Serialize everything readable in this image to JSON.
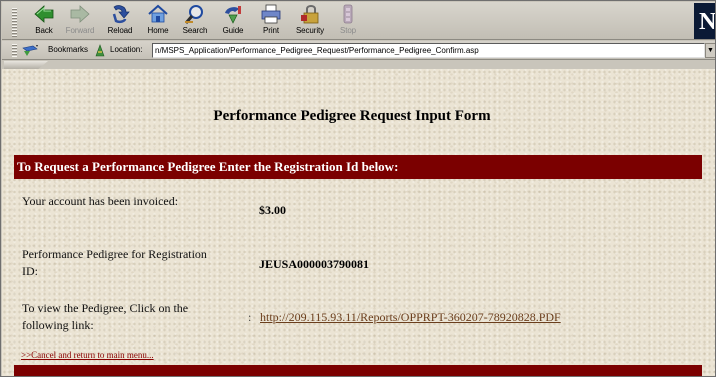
{
  "toolbar": {
    "buttons": [
      {
        "label": "Back",
        "icon": "back-arrow-icon",
        "enabled": true
      },
      {
        "label": "Forward",
        "icon": "forward-arrow-icon",
        "enabled": false
      },
      {
        "label": "Reload",
        "icon": "reload-icon",
        "enabled": true
      },
      {
        "label": "Home",
        "icon": "home-icon",
        "enabled": true
      },
      {
        "label": "Search",
        "icon": "search-icon",
        "enabled": true
      },
      {
        "label": "Guide",
        "icon": "guide-icon",
        "enabled": true
      },
      {
        "label": "Print",
        "icon": "print-icon",
        "enabled": true
      },
      {
        "label": "Security",
        "icon": "security-lock-icon",
        "enabled": true
      },
      {
        "label": "Stop",
        "icon": "stop-icon",
        "enabled": false
      }
    ],
    "logo_letter": "N"
  },
  "location_bar": {
    "bookmarks_label": "Bookmarks",
    "location_label": "Location:",
    "url": "n/MSPS_Application/Performance_Pedigree_Request/Performance_Pedigree_Confirm.asp"
  },
  "page": {
    "title": "Performance Pedigree Request Input Form",
    "banner": "To Request a Performance Pedigree Enter the Registration Id below:",
    "rows": [
      {
        "label": "Your account has been invoiced:",
        "value": "$3.00"
      },
      {
        "label": "Performance Pedigree for Registration ID:",
        "value": "JEUSA000003790081"
      },
      {
        "label": "To view the Pedigree, Click on the following link:",
        "separator": ":",
        "link": "http://209.115.93.11/Reports/OPPRPT-360207-78920828.PDF"
      }
    ],
    "cancel_link": ">>Cancel and return to main menu..."
  },
  "colors": {
    "banner": "#7b0000",
    "link": "#6b3e1c",
    "page_background": "#ebe4d4",
    "chrome": "#c9c5bb"
  }
}
